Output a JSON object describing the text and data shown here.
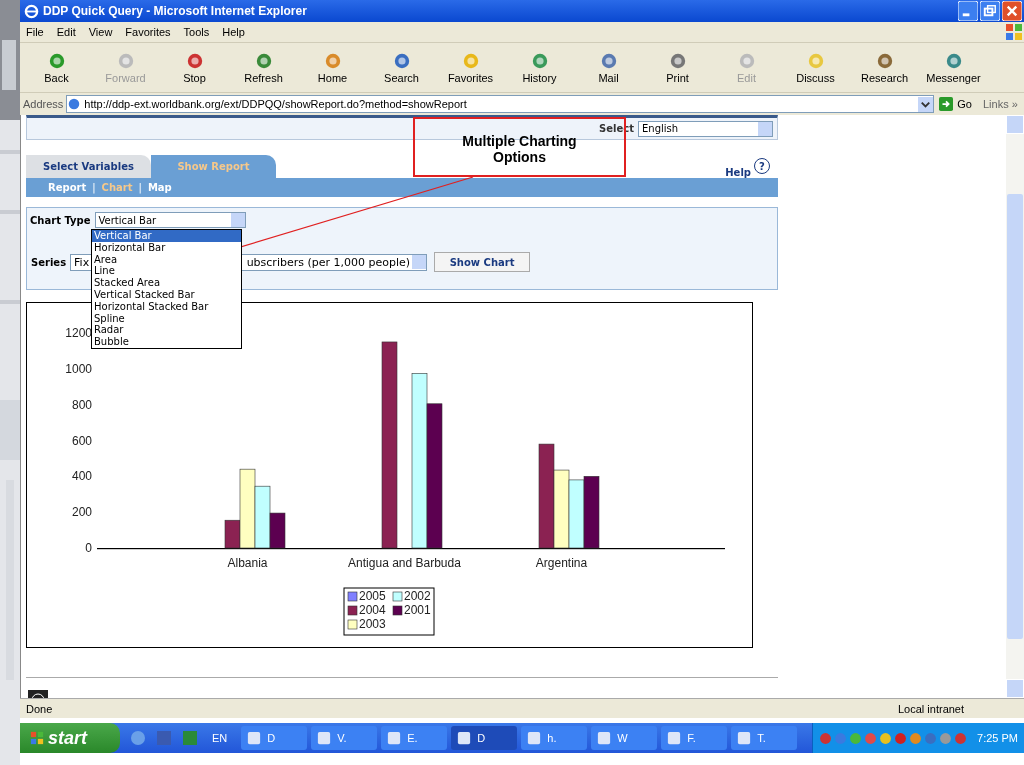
{
  "window": {
    "title": "DDP Quick Query - Microsoft Internet Explorer"
  },
  "menu": [
    "File",
    "Edit",
    "View",
    "Favorites",
    "Tools",
    "Help"
  ],
  "toolbar": [
    {
      "label": "Back",
      "disabled": false
    },
    {
      "label": "Forward",
      "disabled": true
    },
    {
      "label": "Stop",
      "disabled": false
    },
    {
      "label": "Refresh",
      "disabled": false
    },
    {
      "label": "Home",
      "disabled": false
    },
    {
      "label": "Search",
      "disabled": false
    },
    {
      "label": "Favorites",
      "disabled": false
    },
    {
      "label": "History",
      "disabled": false
    },
    {
      "label": "Mail",
      "disabled": false
    },
    {
      "label": "Print",
      "disabled": false
    },
    {
      "label": "Edit",
      "disabled": true
    },
    {
      "label": "Discuss",
      "disabled": false
    },
    {
      "label": "Research",
      "disabled": false
    },
    {
      "label": "Messenger",
      "disabled": false
    }
  ],
  "address": {
    "label": "Address",
    "url": "http://ddp-ext.worldbank.org/ext/DDPQQ/showReport.do?method=showReport",
    "go": "Go",
    "links": "Links »"
  },
  "page": {
    "language_label": "Select",
    "language": "English",
    "tabs": [
      {
        "label": "Select Variables",
        "selected": false
      },
      {
        "label": "Show Report",
        "selected": true
      }
    ],
    "help": "Help",
    "help_icon": "?",
    "views": [
      {
        "label": "Report",
        "selected": false
      },
      {
        "label": "Chart",
        "selected": true
      },
      {
        "label": "Map",
        "selected": false
      }
    ],
    "separator": "|",
    "chart_type": {
      "label": "Chart Type",
      "value": "Vertical Bar",
      "options": [
        {
          "label": "Vertical Bar",
          "selected": true
        },
        {
          "label": "Horizontal Bar",
          "selected": false
        },
        {
          "label": "Area",
          "selected": false
        },
        {
          "label": "Line",
          "selected": false
        },
        {
          "label": "Stacked Area",
          "selected": false
        },
        {
          "label": "Vertical Stacked Bar",
          "selected": false
        },
        {
          "label": "Horizontal Stacked Bar",
          "selected": false
        },
        {
          "label": "Spline",
          "selected": false
        },
        {
          "label": "Radar",
          "selected": false
        },
        {
          "label": "Bubble",
          "selected": false
        }
      ]
    },
    "series": {
      "label": "Series",
      "value_start": "Fix",
      "value_end": "ubscribers (per 1,000 people)"
    },
    "show_chart": "Show Chart",
    "chart_data": {
      "type": "bar",
      "legend": "bottom",
      "categories": [
        "Albania",
        "Antigua and Barbuda",
        "Argentina"
      ],
      "ylim": [
        0,
        1200
      ],
      "yticks": [
        0,
        200,
        400,
        600,
        800,
        1000,
        1200
      ],
      "series": [
        {
          "name": "2005",
          "color": "#8080ff",
          "values": [
            null,
            null,
            null
          ]
        },
        {
          "name": "2004",
          "color": "#8b2252",
          "values": [
            155,
            1150,
            580
          ]
        },
        {
          "name": "2003",
          "color": "#ffffc0",
          "values": [
            440,
            null,
            435
          ]
        },
        {
          "name": "2002",
          "color": "#c0ffff",
          "values": [
            345,
            975,
            380
          ]
        },
        {
          "name": "2001",
          "color": "#5c0050",
          "values": [
            195,
            805,
            400
          ]
        }
      ]
    }
  },
  "annotation": "Multiple Charting Options",
  "status_bar": {
    "text": "Done",
    "zone": "Local intranet"
  },
  "taskbar": {
    "start": "start",
    "language": "EN",
    "tasks": [
      {
        "label": "D",
        "selected": false
      },
      {
        "label": "V.",
        "selected": false
      },
      {
        "label": "E.",
        "selected": false
      },
      {
        "label": "D",
        "selected": true
      },
      {
        "label": "h.",
        "selected": false
      },
      {
        "label": "W",
        "selected": false
      },
      {
        "label": "F.",
        "selected": false
      },
      {
        "label": "T.",
        "selected": false
      }
    ],
    "time": "7:25 PM"
  }
}
